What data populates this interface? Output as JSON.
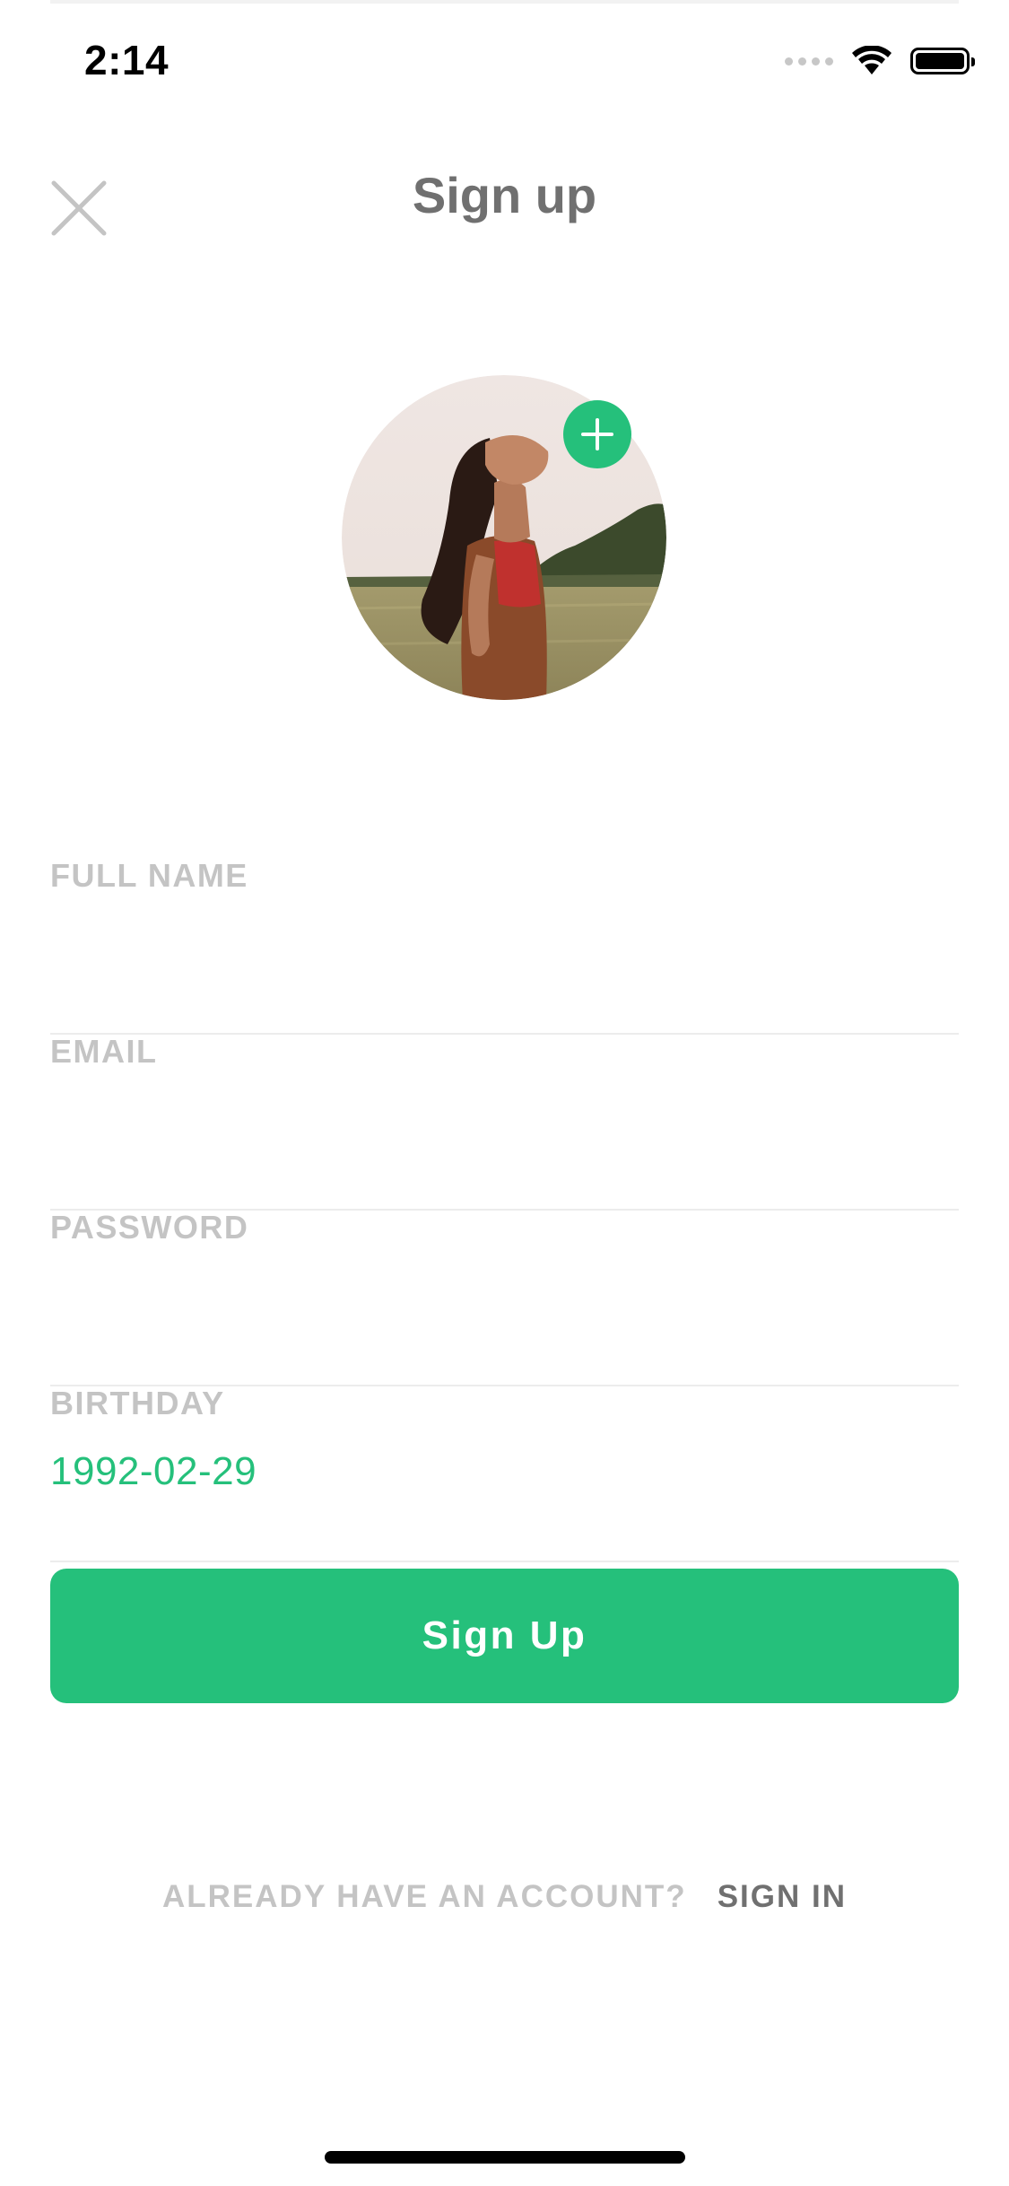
{
  "status_bar": {
    "time": "2:14",
    "icons": [
      "signal-icon",
      "wifi-icon",
      "battery-icon"
    ]
  },
  "header": {
    "title": "Sign up",
    "close_icon": "close-icon"
  },
  "avatar": {
    "add_icon": "plus-icon",
    "accent_color": "#25c07b"
  },
  "form": {
    "full_name": {
      "label": "FULL NAME",
      "value": ""
    },
    "email": {
      "label": "EMAIL",
      "value": ""
    },
    "password": {
      "label": "PASSWORD",
      "value": ""
    },
    "birthday": {
      "label": "BIRTHDAY",
      "value": "1992-02-29"
    }
  },
  "signup_button": {
    "label": "Sign Up"
  },
  "footer": {
    "prompt": "ALREADY HAVE AN ACCOUNT?",
    "link": "SIGN IN"
  },
  "colors": {
    "accent": "#25c07b",
    "title": "#707070",
    "label": "#c4c4c4",
    "divider": "#ececec"
  }
}
